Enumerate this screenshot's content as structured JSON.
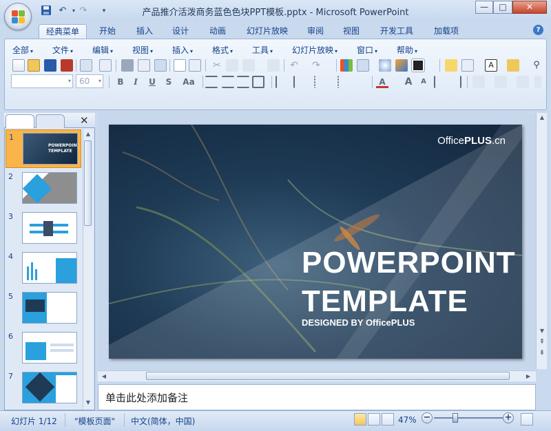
{
  "titlebar": {
    "document_title": "产品推介活泼商务蓝色色块PPT模板.pptx - Microsoft PowerPoint",
    "quick_access": [
      "save-icon",
      "undo-icon",
      "redo-icon",
      "customize-icon"
    ],
    "window_buttons": {
      "minimize": "—",
      "maximize": "□",
      "close": "✕"
    }
  },
  "ribbon_tabs": [
    "经典菜单",
    "开始",
    "插入",
    "设计",
    "动画",
    "幻灯片放映",
    "审阅",
    "视图",
    "开发工具",
    "加载项"
  ],
  "active_tab": "经典菜单",
  "classic_menu": [
    "全部",
    "文件",
    "编辑",
    "视图",
    "插入",
    "格式",
    "工具",
    "幻灯片放映",
    "窗口",
    "帮助"
  ],
  "format_toolbar": {
    "font_name_value": "",
    "font_size_value": "60",
    "bold": "B",
    "italic": "I",
    "underline": "U",
    "shadow": "S",
    "case": "Aa"
  },
  "slide_pane": {
    "slide_numbers": [
      "1",
      "2",
      "3",
      "4",
      "5",
      "6",
      "7"
    ],
    "selected_index": 1
  },
  "slide": {
    "brand_prefix": "Office",
    "brand_suffix": "PLUS",
    "brand_domain": ".cn",
    "title_line1": "POWERPOINT",
    "title_line2": "TEMPLATE",
    "subtitle": "DESIGNED BY OfficePLUS"
  },
  "thumbnail_text": {
    "line1": "POWERPOINT",
    "line2": "TEMPLATE"
  },
  "notes_placeholder": "单击此处添加备注",
  "statusbar": {
    "slide_position": "幻灯片 1/12",
    "theme_name": "\"模板页面\"",
    "language": "中文(简体，中国)",
    "zoom_level": "47%",
    "zoom_fraction": 0.3
  },
  "colors": {
    "accent_blue": "#2aa0dc",
    "selected_thumb": "#f9b44a"
  }
}
